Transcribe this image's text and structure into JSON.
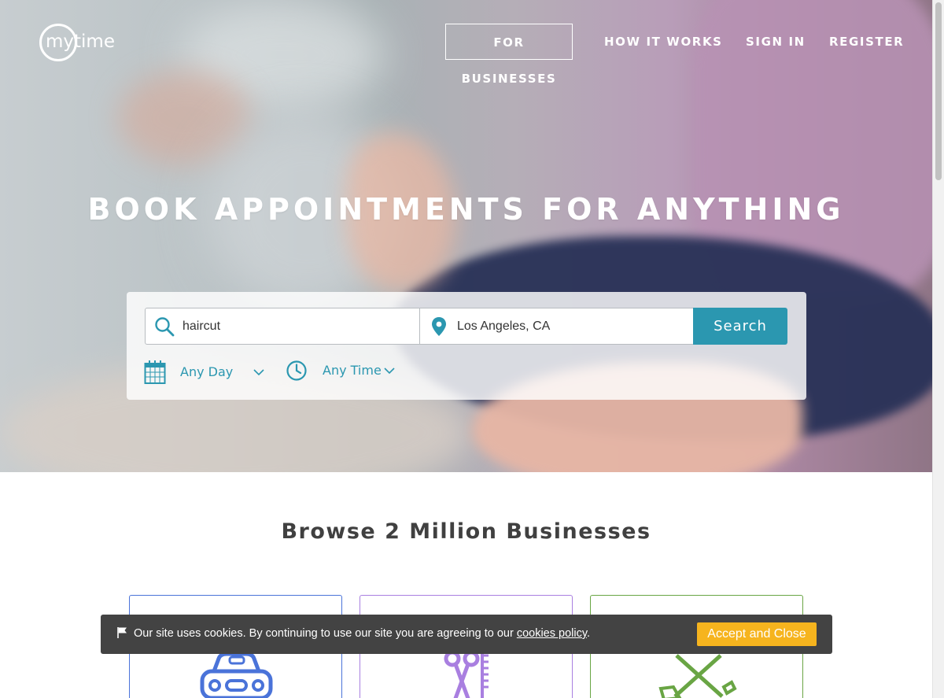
{
  "brand": {
    "logo_text": "mytime"
  },
  "nav": {
    "for_businesses": "FOR BUSINESSES",
    "how_it_works": "HOW IT WORKS",
    "sign_in": "SIGN IN",
    "register": "REGISTER"
  },
  "hero": {
    "headline": "BOOK APPOINTMENTS FOR ANYTHING"
  },
  "search": {
    "what_value": "haircut",
    "where_value": "Los Angeles, CA",
    "button_label": "Search",
    "day_filter": "Any Day",
    "time_filter": "Any Time"
  },
  "browse": {
    "title": "Browse 2 Million Businesses",
    "categories": [
      {
        "icon": "car-icon",
        "color": "#4a73d9"
      },
      {
        "icon": "scissors-comb-icon",
        "color": "#a97fe0"
      },
      {
        "icon": "crossed-tools-icon",
        "color": "#69a544"
      }
    ]
  },
  "cookie_bar": {
    "message_before_link": "Our site uses cookies. By continuing to use our site you are agreeing to our ",
    "link_text": "cookies policy",
    "message_after_link": ".",
    "accept_label": "Accept and Close"
  },
  "colors": {
    "accent": "#2b97b0",
    "cookie_button": "#f6b41e",
    "cookie_bar": "#434343"
  }
}
